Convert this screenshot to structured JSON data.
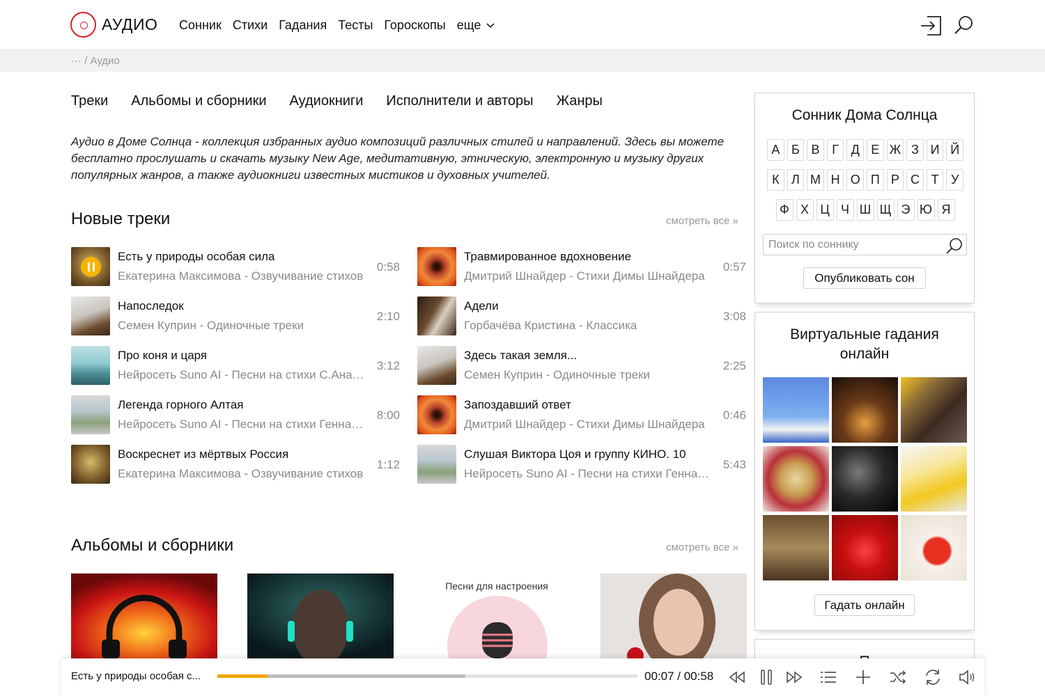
{
  "header": {
    "logo_text": "АУДИО",
    "nav": [
      "Сонник",
      "Стихи",
      "Гадания",
      "Тесты",
      "Гороскопы",
      "еще"
    ]
  },
  "breadcrumb": "··· / Аудио",
  "tabs": [
    "Треки",
    "Альбомы и сборники",
    "Аудиокниги",
    "Исполнители и авторы",
    "Жанры"
  ],
  "intro": "Аудио в Доме Солнца - коллекция избранных аудио композиций различных стилей и направлений. Здесь вы можете бесплатно прослушать и скачать музыку New Age, медитативную, этническую, электронную и музыку других популярных жанров, а также аудиокниги известных мистиков и духовных учителей.",
  "new_tracks": {
    "title": "Новые треки",
    "see_all": "смотреть все »",
    "left": [
      {
        "title": "Есть у природы особая сила",
        "sub": "Екатерина Максимова - Озвучивание стихов",
        "dur": "0:58"
      },
      {
        "title": "Напоследок",
        "sub": "Семен Куприн - Одиночные треки",
        "dur": "2:10"
      },
      {
        "title": "Про коня и царя",
        "sub": "Нейросеть Suno AI - Песни на стихи С.Ананьева",
        "dur": "3:12"
      },
      {
        "title": "Легенда горного Алтая",
        "sub": "Нейросеть Suno AI - Песни на стихи Геннадия",
        "dur": "8:00"
      },
      {
        "title": "Воскреснет из мёртвых Россия",
        "sub": "Екатерина Максимова - Озвучивание стихов",
        "dur": "1:12"
      }
    ],
    "right": [
      {
        "title": "Травмированное вдохновение",
        "sub": "Дмитрий Шнайдер - Стихи Димы Шнайдера",
        "dur": "0:57"
      },
      {
        "title": "Адели",
        "sub": "Горбачёва Кристина - Классика",
        "dur": "3:08"
      },
      {
        "title": "Здесь такая земля...",
        "sub": "Семен Куприн - Одиночные треки",
        "dur": "2:25"
      },
      {
        "title": "Запоздавший ответ",
        "sub": "Дмитрий Шнайдер - Стихи Димы Шнайдера",
        "dur": "0:46"
      },
      {
        "title": "Слушая Виктора Цоя и группу КИНО. 10",
        "sub": "Нейросеть Suno AI - Песни на стихи Геннадия",
        "dur": "5:43"
      }
    ]
  },
  "albums": {
    "title": "Альбомы и сборники",
    "see_all": "смотреть все »",
    "album3_caption": "Песни для настроения"
  },
  "sidebar": {
    "dream_title": "Сонник Дома Солнца",
    "letters_row1": [
      "А",
      "Б",
      "В",
      "Г",
      "Д",
      "Е",
      "Ж",
      "З",
      "И",
      "Й"
    ],
    "letters_row2": [
      "К",
      "Л",
      "М",
      "Н",
      "О",
      "П",
      "Р",
      "С",
      "Т",
      "У"
    ],
    "letters_row3": [
      "Ф",
      "Х",
      "Ц",
      "Ч",
      "Ш",
      "Щ",
      "Э",
      "Ю",
      "Я"
    ],
    "search_placeholder": "Поиск по соннику",
    "publish_button": "Опубликовать сон",
    "divination_title": "Виртуальные гадания онлайн",
    "divination_button": "Гадать онлайн",
    "next_box_title": "П"
  },
  "player": {
    "track": "Есть у природы особая с...",
    "time": "00:07 / 00:58",
    "progress": 0.12,
    "buffered": 0.59
  }
}
